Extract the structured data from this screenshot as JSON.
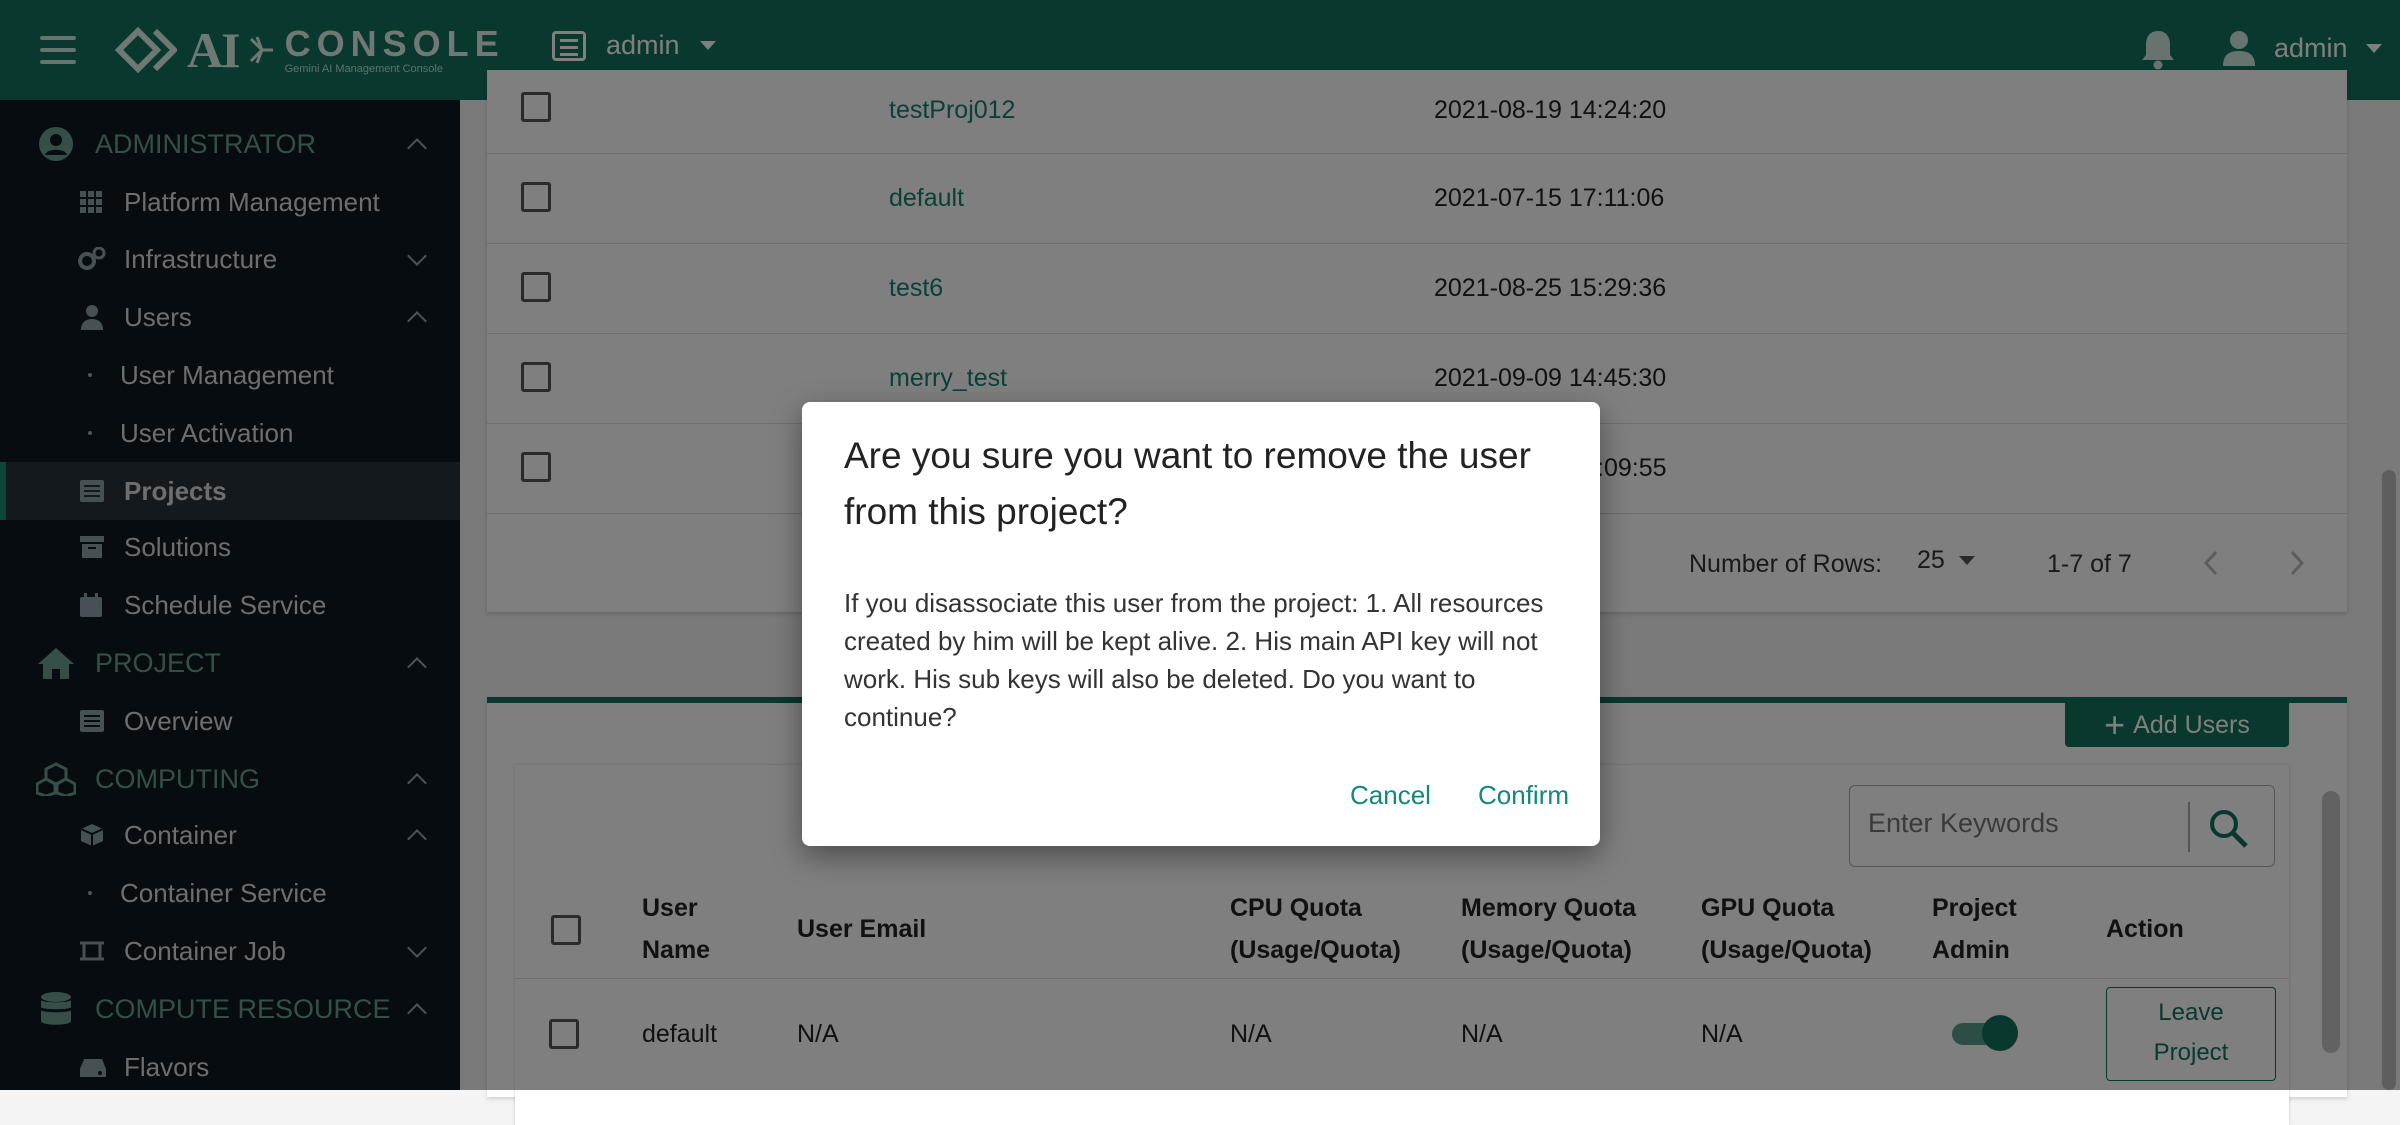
{
  "topbar": {
    "logo_ai": "AI",
    "logo_console": "CONSOLE",
    "logo_sub": "Gemini AI Management Console",
    "project_selector": "admin",
    "user_name": "admin"
  },
  "sidebar": {
    "administrator": "ADMINISTRATOR",
    "platform_management": "Platform Management",
    "infrastructure": "Infrastructure",
    "users": "Users",
    "user_management": "User Management",
    "user_activation": "User Activation",
    "projects": "Projects",
    "solutions": "Solutions",
    "schedule_service": "Schedule Service",
    "project": "PROJECT",
    "overview": "Overview",
    "computing": "COMPUTING",
    "container": "Container",
    "container_service": "Container Service",
    "container_job": "Container Job",
    "compute_resource": "COMPUTE RESOURCE",
    "flavors": "Flavors"
  },
  "projects_table": {
    "rows": [
      {
        "name": "testProj012",
        "date": "2021-08-19 14:24:20"
      },
      {
        "name": "default",
        "date": "2021-07-15 17:11:06"
      },
      {
        "name": "test6",
        "date": "2021-08-25 15:29:36"
      },
      {
        "name": "merry_test",
        "date": "2021-09-09 14:45:30"
      },
      {
        "name": "",
        "date": ":09:55"
      }
    ],
    "rows_label": "Number of Rows:",
    "rows_value": "25",
    "range": "1-7 of 7"
  },
  "users_panel": {
    "add_users": "Add Users",
    "search_placeholder": "Enter Keywords",
    "headers": {
      "user_name_1": "User",
      "user_name_2": "Name",
      "user_email": "User Email",
      "cpu_1": "CPU Quota",
      "cpu_2": "(Usage/Quota)",
      "mem_1": "Memory Quota",
      "mem_2": "(Usage/Quota)",
      "gpu_1": "GPU Quota",
      "gpu_2": "(Usage/Quota)",
      "admin_1": "Project",
      "admin_2": "Admin",
      "action": "Action"
    },
    "row": {
      "user_name": "default",
      "email": "N/A",
      "cpu": "N/A",
      "memory": "N/A",
      "gpu": "N/A",
      "leave_1": "Leave",
      "leave_2": "Project"
    }
  },
  "dialog": {
    "title": "Are you sure you want to remove the user from this project?",
    "body": "If you disassociate this user from the project: 1. All resources created by him will be kept alive. 2. His main API key will not work. His sub keys will also be deleted. Do you want to continue?",
    "cancel": "Cancel",
    "confirm": "Confirm"
  },
  "colors": {
    "brand": "#11705c",
    "sidebar_bg": "#0c1821",
    "link": "#158070"
  }
}
